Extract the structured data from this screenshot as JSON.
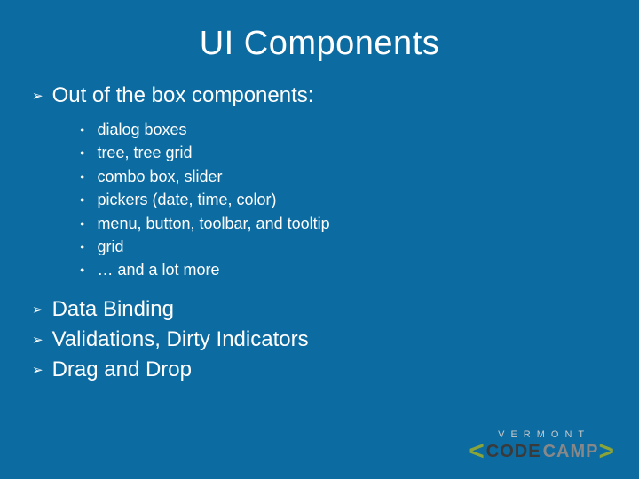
{
  "title": "UI Components",
  "top_items": [
    {
      "label": "Out of the box components:",
      "sub_items": [
        "dialog boxes",
        "tree, tree grid",
        "combo box, slider",
        "pickers (date, time, color)",
        "menu, button, toolbar, and tooltip",
        "grid",
        "… and a lot more"
      ]
    },
    {
      "label": "Data Binding",
      "sub_items": []
    },
    {
      "label": "Validations, Dirty Indicators",
      "sub_items": []
    },
    {
      "label": "Drag and Drop",
      "sub_items": []
    }
  ],
  "logo": {
    "top": "VERMONT",
    "code": "CODE",
    "camp": "CAMP"
  }
}
